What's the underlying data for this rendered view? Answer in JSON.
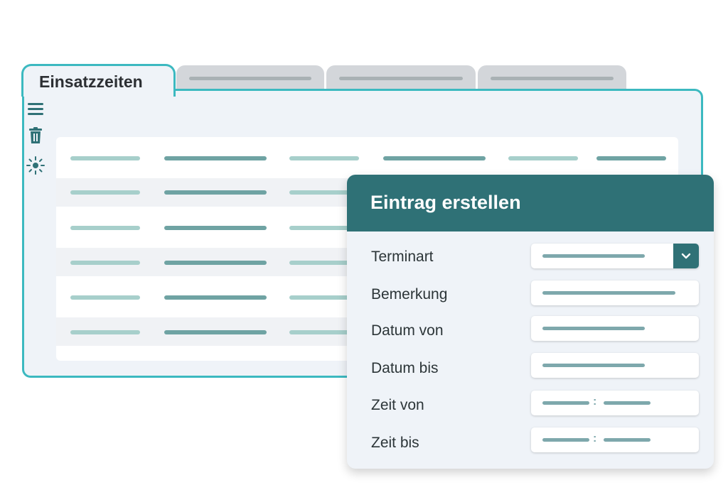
{
  "window": {
    "active_tab_label": "Einsatzzeiten",
    "inactive_tabs": [
      "",
      "",
      ""
    ]
  },
  "toolbar": {
    "icons": [
      "menu-icon",
      "trash-icon",
      "sun-icon"
    ]
  },
  "table": {
    "rows": 6,
    "columns": 6
  },
  "dialog": {
    "title": "Eintrag erstellen",
    "fields": [
      {
        "label": "Terminart",
        "type": "select",
        "value": ""
      },
      {
        "label": "Bemerkung",
        "type": "text",
        "value": ""
      },
      {
        "label": "Datum von",
        "type": "date",
        "value": ""
      },
      {
        "label": "Datum bis",
        "type": "date",
        "value": ""
      },
      {
        "label": "Zeit von",
        "type": "time",
        "value": ""
      },
      {
        "label": "Zeit bis",
        "type": "time",
        "value": ""
      }
    ]
  },
  "colors": {
    "accent": "#3cb9c0",
    "header": "#2f7176",
    "placeholder_dark": "#6fa3a3",
    "placeholder_light": "#a7cfcb"
  }
}
